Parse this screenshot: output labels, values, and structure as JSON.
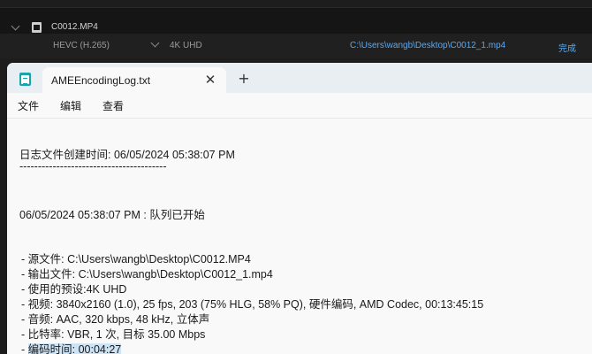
{
  "encoder_queue": {
    "file_name": "C0012.MP4",
    "format": "HEVC (H.265)",
    "preset": "4K UHD",
    "output_path": "C:\\Users\\wangb\\Desktop\\C0012_1.mp4",
    "status": "完成"
  },
  "notepad": {
    "tab_title": "AMEEncodingLog.txt",
    "close_glyph": "✕",
    "new_tab_glyph": "+",
    "menu": [
      "文件",
      "编辑",
      "查看"
    ]
  },
  "log": {
    "created_line": "日志文件创建时间: 06/05/2024 05:38:07 PM",
    "separator": "----------------------------------------",
    "queue_start": "06/05/2024 05:38:07 PM : 队列已开始",
    "source": "- 源文件: C:\\Users\\wangb\\Desktop\\C0012.MP4",
    "output": "- 输出文件: C:\\Users\\wangb\\Desktop\\C0012_1.mp4",
    "preset": "- 使用的预设:4K UHD",
    "video": "- 视频: 3840x2160 (1.0), 25 fps, 203 (75% HLG, 58% PQ), 硬件编码, AMD Codec, 00:13:45:15",
    "audio": "- 音频: AAC, 320 kbps, 48 kHz, 立体声",
    "bitrate": "- 比特率: VBR, 1 次, 目标 35.00 Mbps",
    "encode_time_prefix": "- ",
    "encode_time": "编码时间: 00:04:27"
  }
}
